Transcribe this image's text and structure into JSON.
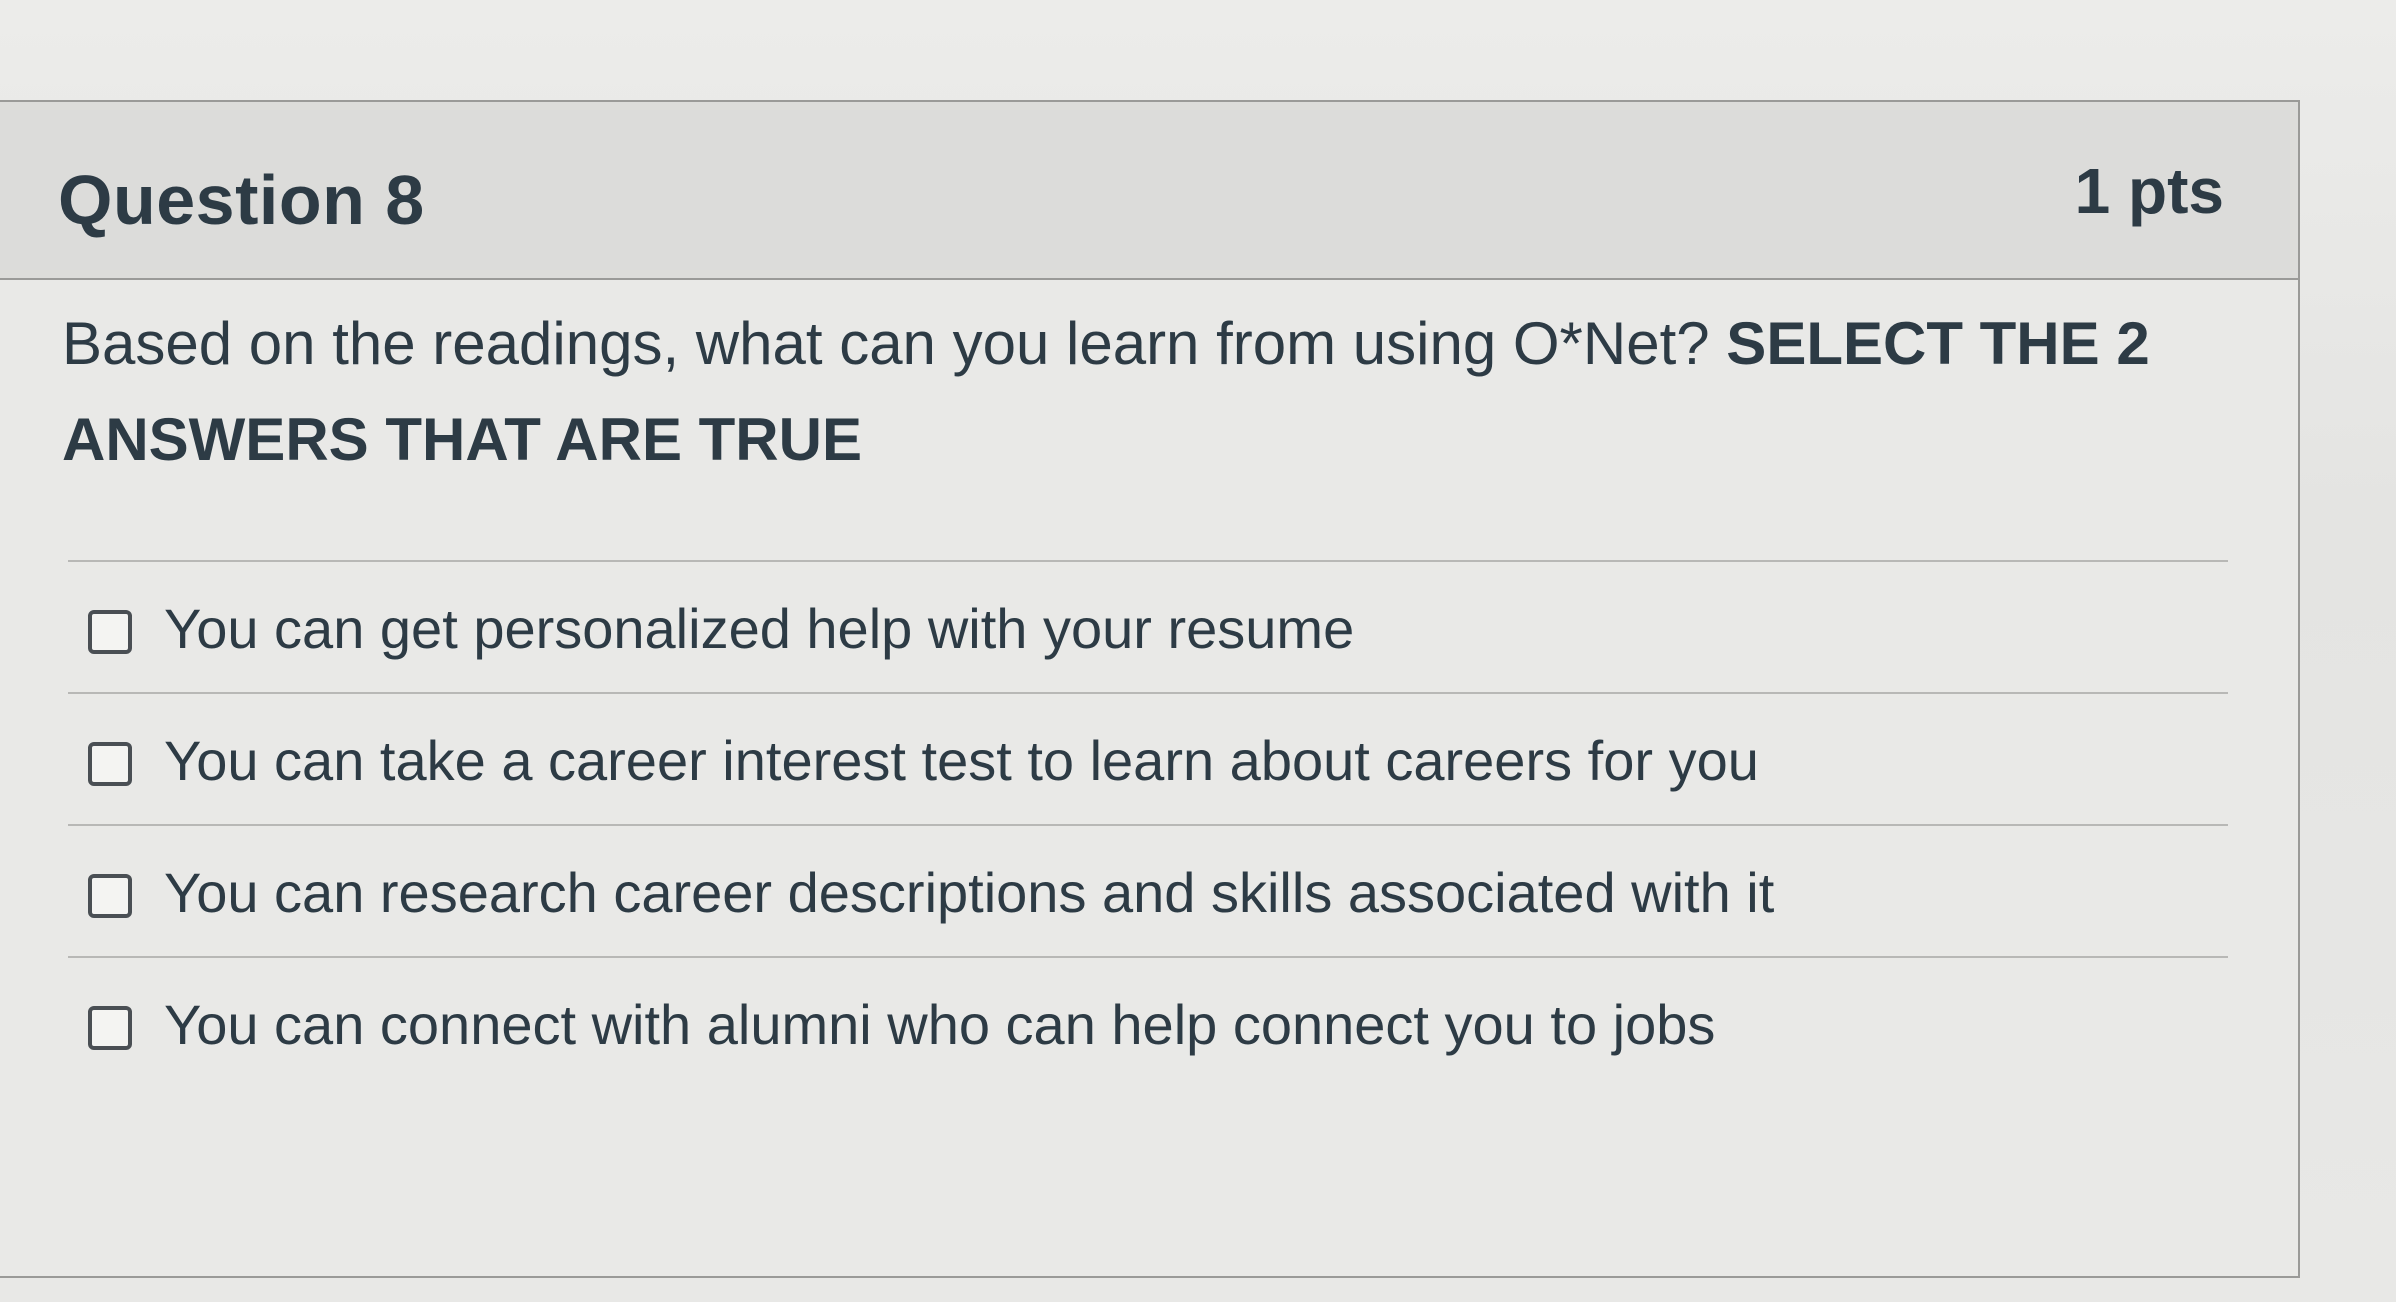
{
  "question": {
    "title": "Question 8",
    "points": "1 pts",
    "text_part1": "Based on the readings, what can you learn from using O*Net? ",
    "text_emphasis": "SELECT THE 2 ANSWERS THAT ARE TRUE"
  },
  "answers": [
    {
      "label": "You can get personalized help with your resume",
      "checked": false
    },
    {
      "label": "You can take a career interest test to learn about careers for you",
      "checked": false
    },
    {
      "label": "You can research career descriptions and skills associated with it",
      "checked": false
    },
    {
      "label": "You can connect with alumni who can help connect you to jobs",
      "checked": false
    }
  ]
}
